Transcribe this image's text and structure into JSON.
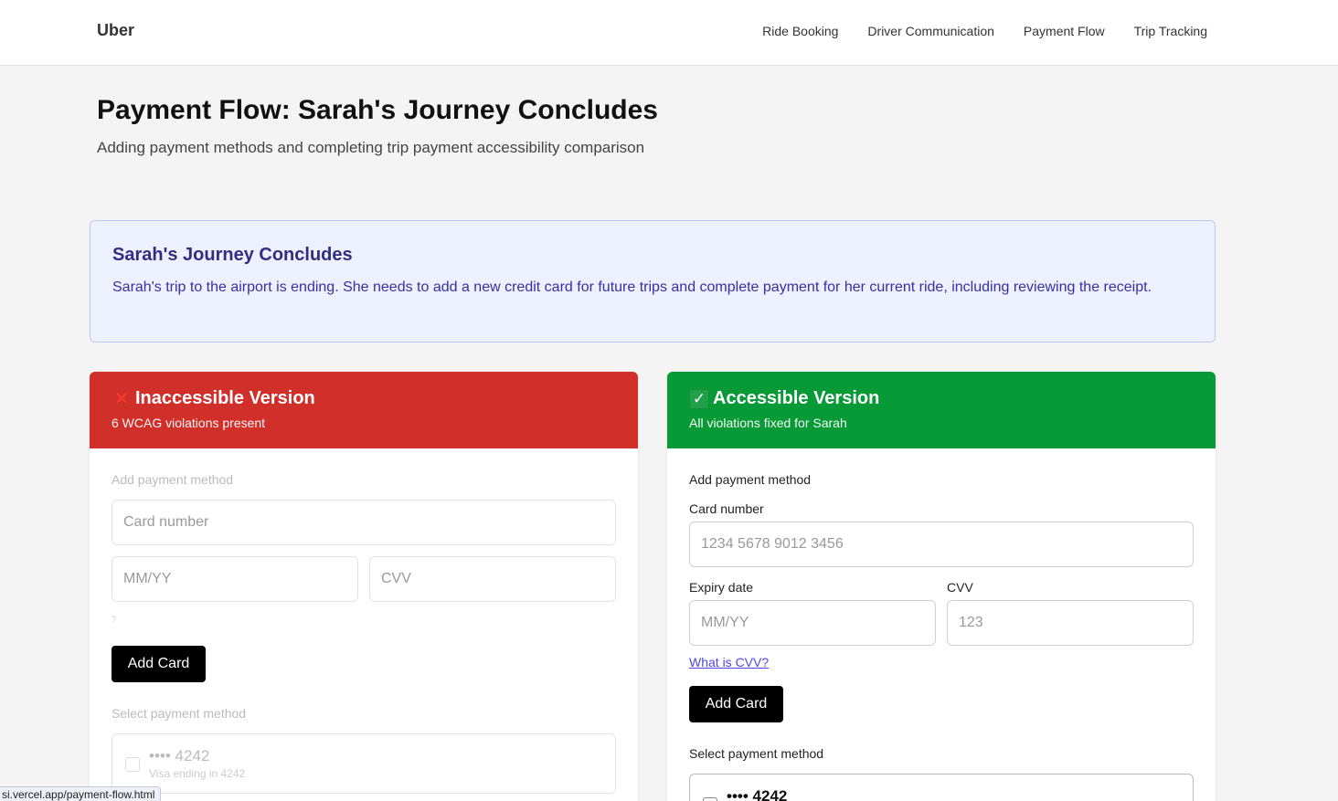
{
  "nav": {
    "brand": "Uber",
    "links": [
      "Ride Booking",
      "Driver Communication",
      "Payment Flow",
      "Trip Tracking"
    ]
  },
  "header": {
    "title": "Payment Flow: Sarah's Journey Concludes",
    "subtitle": "Adding payment methods and completing trip payment accessibility comparison"
  },
  "story": {
    "title": "Sarah's Journey Concludes",
    "text": "Sarah's trip to the airport is ending. She needs to add a new credit card for future trips and complete payment for her current ride, including reviewing the receipt."
  },
  "inaccessible": {
    "title": "Inaccessible Version",
    "subtitle": "6 WCAG violations present",
    "icon": "cross-mark-icon",
    "section_label": "Add payment method",
    "card_placeholder": "Card number",
    "expiry_placeholder": "MM/YY",
    "cvv_placeholder": "CVV",
    "hint": "?",
    "add_button": "Add Card",
    "select_label": "Select payment method",
    "saved_card": {
      "number": "•••• 4242",
      "desc": "Visa ending in 4242"
    }
  },
  "accessible": {
    "title": "Accessible Version",
    "subtitle": "All violations fixed for Sarah",
    "icon": "check-mark-icon",
    "section_label": "Add payment method",
    "card_label": "Card number",
    "card_placeholder": "1234 5678 9012 3456",
    "expiry_label": "Expiry date",
    "expiry_placeholder": "MM/YY",
    "cvv_label": "CVV",
    "cvv_placeholder": "123",
    "cvv_help_link": "What is CVV?",
    "add_button": "Add Card",
    "select_label": "Select payment method",
    "saved_card": {
      "number": "•••• 4242"
    }
  },
  "statusbar": {
    "url": "si.vercel.app/payment-flow.html"
  },
  "colors": {
    "bad_header": "#d12f2a",
    "good_header": "#079a36",
    "story_bg": "#edf0fd",
    "story_text": "#3730a3"
  }
}
